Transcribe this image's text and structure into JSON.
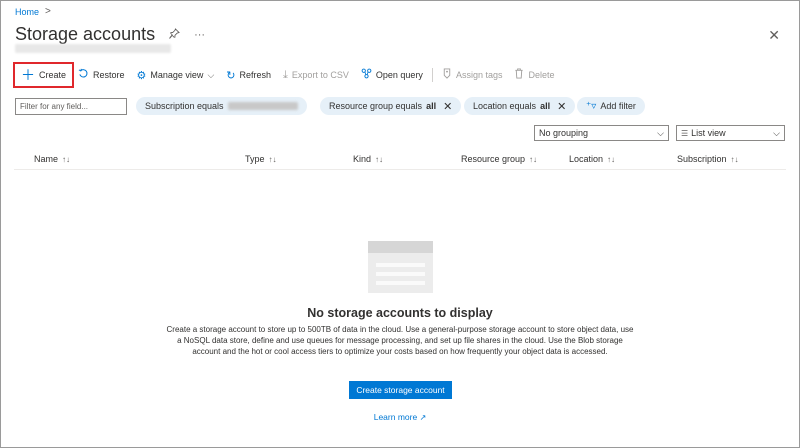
{
  "breadcrumb": {
    "home": "Home",
    "separator": ">"
  },
  "header": {
    "title": "Storage accounts",
    "pin_icon": "pin-icon",
    "more_label": "···",
    "close_label": "✕"
  },
  "toolbar": {
    "create": "Create",
    "restore": "Restore",
    "manage_view": "Manage view",
    "refresh": "Refresh",
    "export_csv": "Export to CSV",
    "open_query": "Open query",
    "assign_tags": "Assign tags",
    "delete": "Delete"
  },
  "filters": {
    "search_placeholder": "Filter for any field...",
    "subscription_label": "Subscription equals",
    "resource_group_label": "Resource group equals",
    "resource_group_value": "all",
    "location_label": "Location equals",
    "location_value": "all",
    "add_filter": "Add filter"
  },
  "grouping": {
    "selected": "No grouping"
  },
  "view": {
    "selected": "List view"
  },
  "table": {
    "columns": [
      "Name",
      "Type",
      "Kind",
      "Resource group",
      "Location",
      "Subscription"
    ],
    "sort_glyph": "↑↓"
  },
  "empty_state": {
    "title": "No storage accounts to display",
    "description": "Create a storage account to store up to 500TB of data in the cloud. Use a general-purpose storage account to store object data, use a NoSQL data store, define and use queues for message processing, and set up file shares in the cloud. Use the Blob storage account and the hot or cool access tiers to optimize your costs based on how frequently your object data is accessed.",
    "create_button": "Create storage account",
    "learn_more": "Learn more"
  },
  "colors": {
    "accent": "#0078d4",
    "highlight": "#e0282c",
    "pill_bg": "#e6f0f8"
  }
}
